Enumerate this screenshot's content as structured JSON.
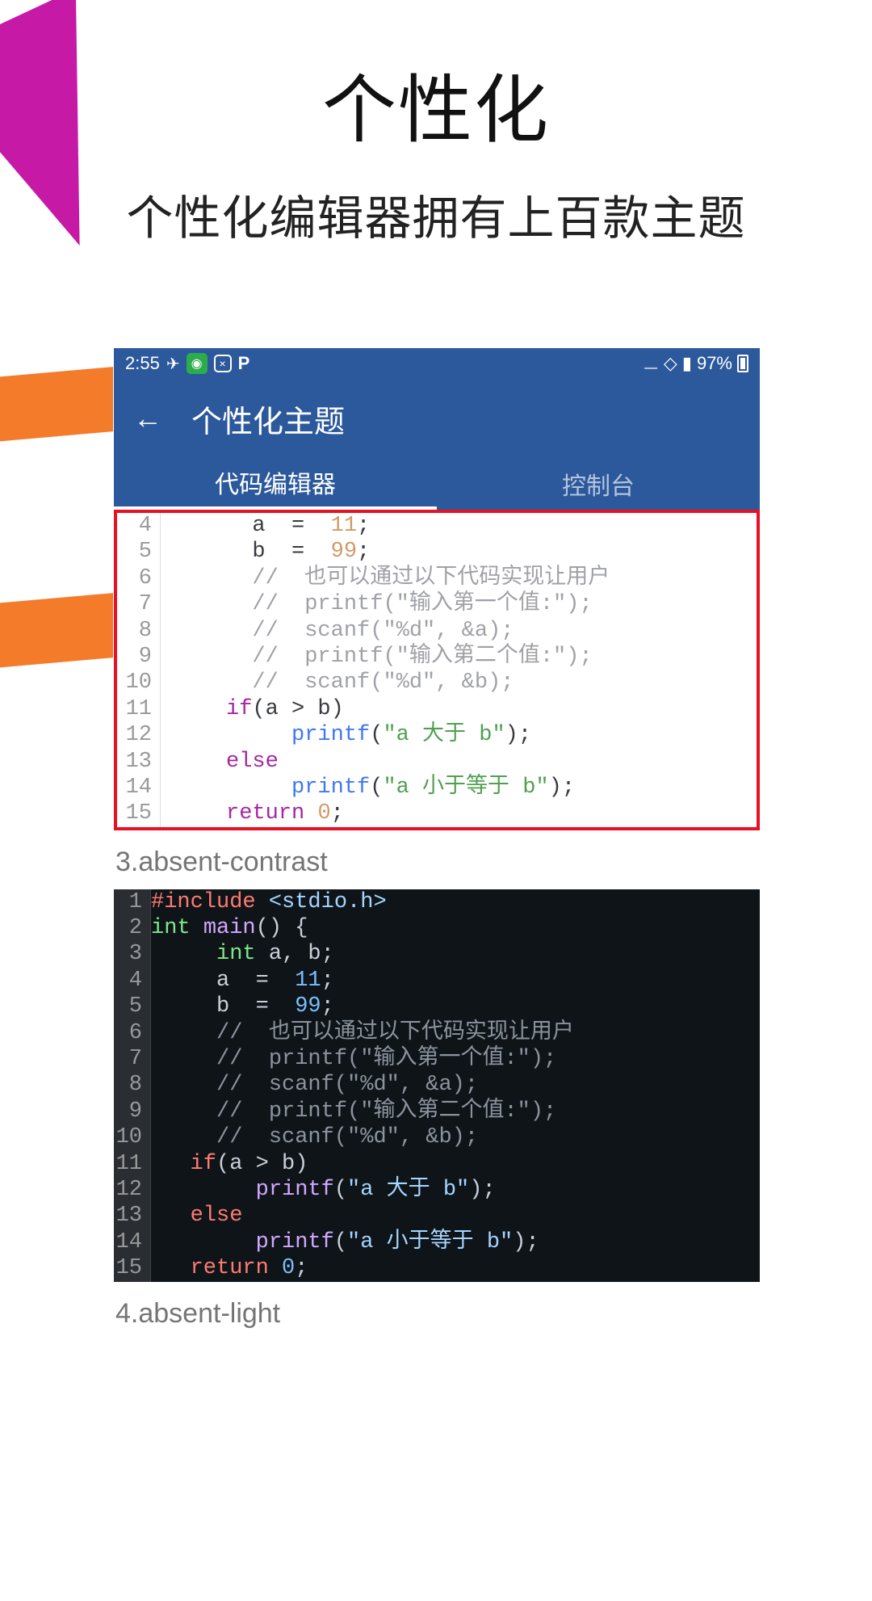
{
  "page": {
    "title": "个性化",
    "subtitle": "个性化编辑器拥有上百款主题"
  },
  "statusBar": {
    "time": "2:55",
    "battery": "97%"
  },
  "appBar": {
    "title": "个性化主题"
  },
  "tabs": {
    "active": "代码编辑器",
    "inactive": "控制台"
  },
  "themes": {
    "label3": "3.absent-contrast",
    "label4": "4.absent-light"
  },
  "lightCode": [
    {
      "n": "4",
      "indent": "       ",
      "tokens": [
        [
          "default",
          "a  =  "
        ],
        [
          "number",
          "11"
        ],
        [
          "default",
          ";"
        ]
      ]
    },
    {
      "n": "5",
      "indent": "       ",
      "tokens": [
        [
          "default",
          "b  =  "
        ],
        [
          "number",
          "99"
        ],
        [
          "default",
          ";"
        ]
      ]
    },
    {
      "n": "6",
      "indent": "       ",
      "tokens": [
        [
          "comment",
          "//  也可以通过以下代码实现让用户"
        ]
      ]
    },
    {
      "n": "7",
      "indent": "       ",
      "tokens": [
        [
          "comment",
          "//  printf(\"输入第一个值:\");"
        ]
      ]
    },
    {
      "n": "8",
      "indent": "       ",
      "tokens": [
        [
          "comment",
          "//  scanf(\"%d\", &a);"
        ]
      ]
    },
    {
      "n": "9",
      "indent": "       ",
      "tokens": [
        [
          "comment",
          "//  printf(\"输入第二个值:\");"
        ]
      ]
    },
    {
      "n": "10",
      "indent": "       ",
      "tokens": [
        [
          "comment",
          "//  scanf(\"%d\", &b);"
        ]
      ]
    },
    {
      "n": "11",
      "indent": "     ",
      "tokens": [
        [
          "keyword",
          "if"
        ],
        [
          "default",
          "(a > b)"
        ]
      ]
    },
    {
      "n": "12",
      "indent": "          ",
      "tokens": [
        [
          "func",
          "printf"
        ],
        [
          "default",
          "("
        ],
        [
          "string",
          "\"a 大于 b\""
        ],
        [
          "default",
          ");"
        ]
      ]
    },
    {
      "n": "13",
      "indent": "     ",
      "tokens": [
        [
          "keyword",
          "else"
        ]
      ]
    },
    {
      "n": "14",
      "indent": "          ",
      "tokens": [
        [
          "func",
          "printf"
        ],
        [
          "default",
          "("
        ],
        [
          "string",
          "\"a 小于等于 b\""
        ],
        [
          "default",
          ");"
        ]
      ]
    },
    {
      "n": "15",
      "indent": "     ",
      "tokens": [
        [
          "keyword",
          "return"
        ],
        [
          "default",
          " "
        ],
        [
          "number",
          "0"
        ],
        [
          "default",
          ";"
        ]
      ]
    }
  ],
  "darkCode": [
    {
      "n": "1",
      "indent": "",
      "tokens": [
        [
          "keyword",
          "#include"
        ],
        [
          "default",
          " "
        ],
        [
          "string",
          "<stdio.h>"
        ]
      ]
    },
    {
      "n": "2",
      "indent": "",
      "tokens": [
        [
          "type",
          "int"
        ],
        [
          "default",
          " "
        ],
        [
          "func",
          "main"
        ],
        [
          "default",
          "() {"
        ]
      ]
    },
    {
      "n": "3",
      "indent": "     ",
      "tokens": [
        [
          "type",
          "int"
        ],
        [
          "default",
          " a, b;"
        ]
      ]
    },
    {
      "n": "4",
      "indent": "     ",
      "tokens": [
        [
          "default",
          "a  =  "
        ],
        [
          "number",
          "11"
        ],
        [
          "default",
          ";"
        ]
      ]
    },
    {
      "n": "5",
      "indent": "     ",
      "tokens": [
        [
          "default",
          "b  =  "
        ],
        [
          "number",
          "99"
        ],
        [
          "default",
          ";"
        ]
      ]
    },
    {
      "n": "6",
      "indent": "     ",
      "tokens": [
        [
          "comment",
          "//  也可以通过以下代码实现让用户"
        ]
      ]
    },
    {
      "n": "7",
      "indent": "     ",
      "tokens": [
        [
          "comment",
          "//  printf(\"输入第一个值:\");"
        ]
      ]
    },
    {
      "n": "8",
      "indent": "     ",
      "tokens": [
        [
          "comment",
          "//  scanf(\"%d\", &a);"
        ]
      ]
    },
    {
      "n": "9",
      "indent": "     ",
      "tokens": [
        [
          "comment",
          "//  printf(\"输入第二个值:\");"
        ]
      ]
    },
    {
      "n": "10",
      "indent": "     ",
      "tokens": [
        [
          "comment",
          "//  scanf(\"%d\", &b);"
        ]
      ]
    },
    {
      "n": "11",
      "indent": "   ",
      "tokens": [
        [
          "keyword",
          "if"
        ],
        [
          "default",
          "(a > b)"
        ]
      ]
    },
    {
      "n": "12",
      "indent": "        ",
      "tokens": [
        [
          "func",
          "printf"
        ],
        [
          "default",
          "("
        ],
        [
          "string",
          "\"a 大于 b\""
        ],
        [
          "default",
          ");"
        ]
      ]
    },
    {
      "n": "13",
      "indent": "   ",
      "tokens": [
        [
          "keyword",
          "else"
        ]
      ]
    },
    {
      "n": "14",
      "indent": "        ",
      "tokens": [
        [
          "func",
          "printf"
        ],
        [
          "default",
          "("
        ],
        [
          "string",
          "\"a 小于等于 b\""
        ],
        [
          "default",
          ");"
        ]
      ]
    },
    {
      "n": "15",
      "indent": "   ",
      "tokens": [
        [
          "keyword",
          "return"
        ],
        [
          "default",
          " "
        ],
        [
          "number",
          "0"
        ],
        [
          "default",
          ";"
        ]
      ]
    }
  ]
}
